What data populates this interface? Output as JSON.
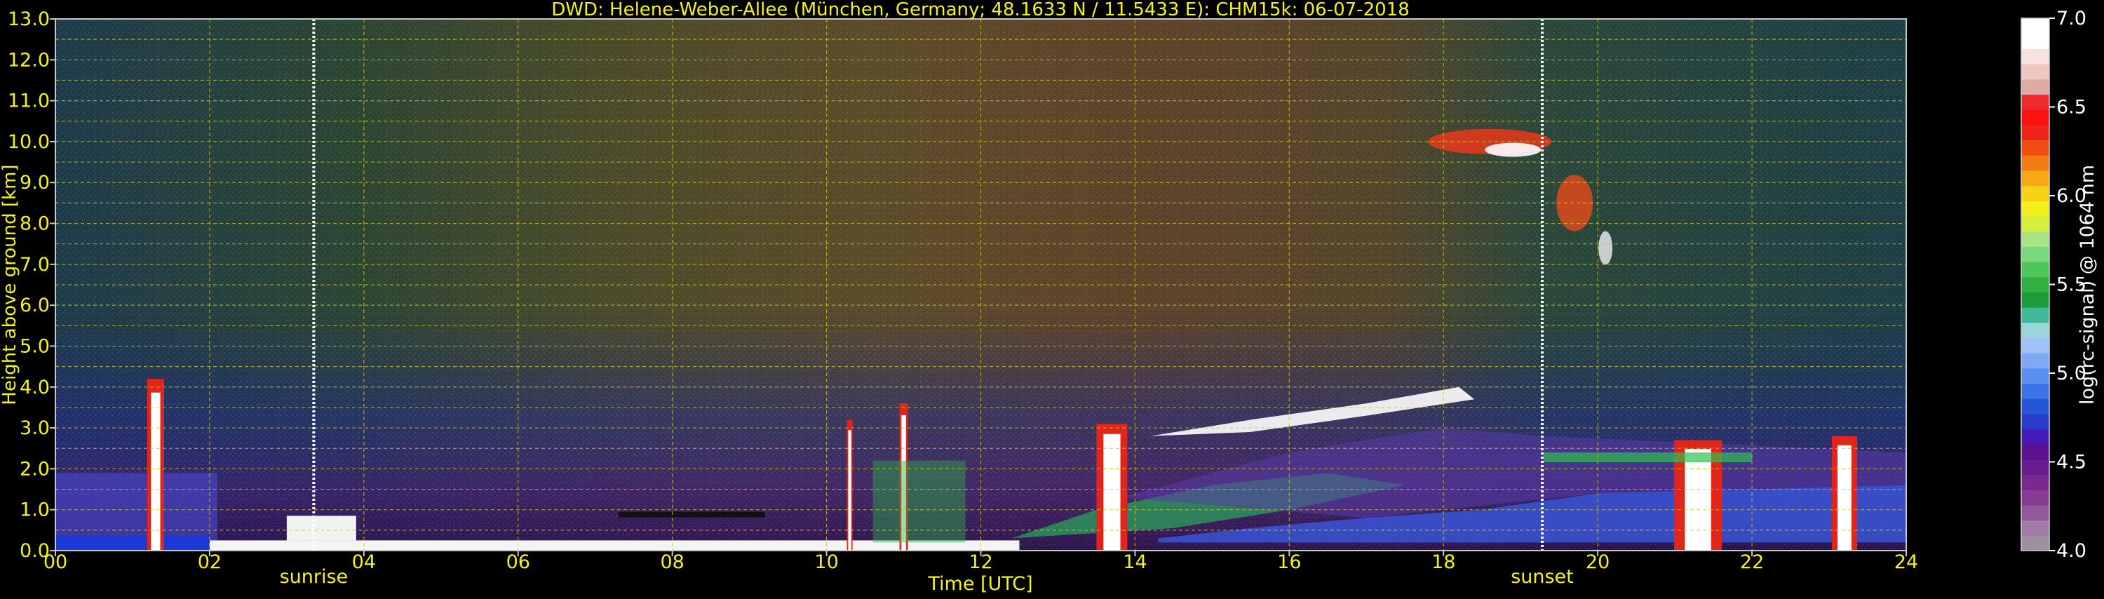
{
  "chart_data": {
    "type": "heatmap",
    "title": "DWD: Helene-Weber-Allee (München, Germany; 48.1633 N / 11.5433 E):    CHM15k: 06-07-2018",
    "xlabel": "Time [UTC]",
    "ylabel": "Height above ground [km]",
    "xlim": [
      0,
      24
    ],
    "ylim": [
      0,
      13
    ],
    "x_ticks": [
      "00",
      "02",
      "04",
      "06",
      "08",
      "10",
      "12",
      "14",
      "16",
      "18",
      "20",
      "22",
      "24"
    ],
    "y_ticks": [
      "0.0",
      "0.5",
      "1.0",
      "1.5",
      "2.0",
      "2.5",
      "3.0",
      "3.5",
      "4.0",
      "4.5",
      "5.0",
      "5.5",
      "6.0",
      "6.5",
      "7.0",
      "7.5",
      "8.0",
      "8.5",
      "9.0",
      "9.5",
      "10.0",
      "10.5",
      "11.0",
      "11.5",
      "12.0",
      "12.5",
      "13.0"
    ],
    "grid": true,
    "colorbar": {
      "label": "log(rc-signal) @ 1064 nm",
      "range": [
        4.0,
        7.0
      ],
      "ticks": [
        "4.0",
        "4.5",
        "5.0",
        "5.5",
        "6.0",
        "6.5",
        "7.0"
      ],
      "colors": [
        "#9b8fa0",
        "#a07ba6",
        "#93589c",
        "#863e94",
        "#7a2a8f",
        "#6a1a8f",
        "#5a1294",
        "#451ab5",
        "#2a3ccd",
        "#2656d8",
        "#3a74e8",
        "#5a8ff0",
        "#7eaaf4",
        "#a0c1f4",
        "#9ad6d8",
        "#40b89a",
        "#1f9c3a",
        "#2fb040",
        "#4ec658",
        "#7ad87c",
        "#a8e484",
        "#d4ef3e",
        "#f4f01c",
        "#f8d214",
        "#f7a817",
        "#f47c14",
        "#f04d12",
        "#ed2418",
        "#ff1010",
        "#ee2a2a",
        "#e0aaa6",
        "#f0c8c2",
        "#f6e2de",
        "#ffffff",
        "#ffffff"
      ]
    },
    "annotations": [
      {
        "label": "sunrise",
        "time": 3.35
      },
      {
        "label": "sunset",
        "time": 19.28
      }
    ],
    "colors": {
      "text": "#f4f21a",
      "frame": "#c8c8c8",
      "grid": "#d4c41c",
      "background": "#000000"
    }
  }
}
